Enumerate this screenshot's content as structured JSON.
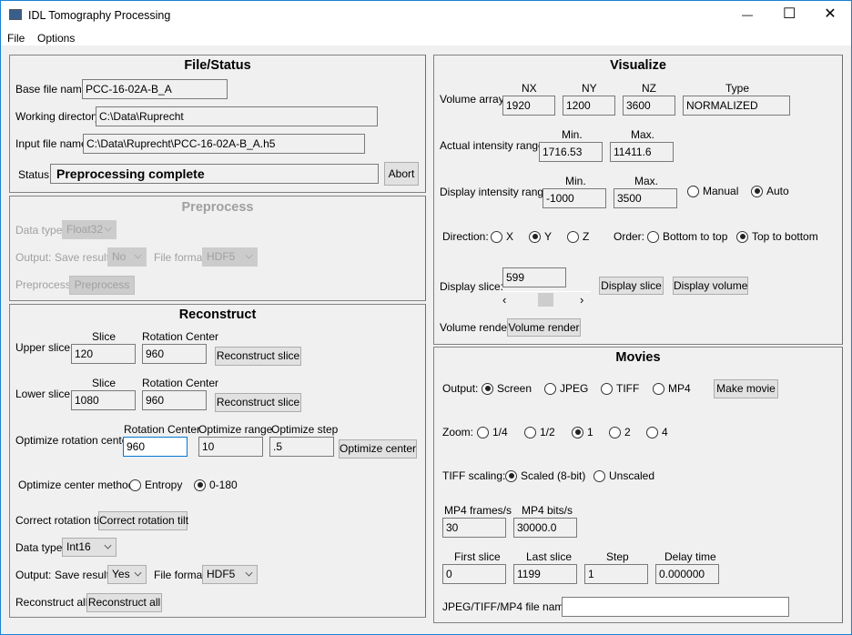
{
  "window": {
    "title": "IDL Tomography Processing",
    "minimize": "—",
    "maximize": "☐",
    "close": "✕"
  },
  "menu": {
    "file": "File",
    "options": "Options"
  },
  "file_status": {
    "title": "File/Status",
    "base_label": "Base file name:",
    "base_value": "PCC-16-02A-B_A",
    "workdir_label": "Working directory:",
    "workdir_value": "C:\\Data\\Ruprecht",
    "input_label": "Input file name:",
    "input_value": "C:\\Data\\Ruprecht\\PCC-16-02A-B_A.h5",
    "status_label": "Status:",
    "status_value": "Preprocessing complete",
    "abort": "Abort"
  },
  "preprocess": {
    "title": "Preprocess",
    "data_type_label": "Data type:",
    "data_type": "Float32",
    "output_label": "Output:",
    "save_label": "Save result:",
    "save_value": "No",
    "format_label": "File format:",
    "format_value": "HDF5",
    "preprocess_label": "Preprocess:",
    "preprocess_button": "Preprocess"
  },
  "reconstruct": {
    "title": "Reconstruct",
    "slice_header": "Slice",
    "rot_header": "Rotation Center",
    "upper_label": "Upper slice:",
    "upper_slice": "120",
    "upper_center": "960",
    "lower_label": "Lower slice:",
    "lower_slice": "1080",
    "lower_center": "960",
    "recon_slice_button": "Reconstruct slice",
    "opt_label": "Optimize rotation center:",
    "opt_center_header": "Rotation Center",
    "opt_range_header": "Optimize range",
    "opt_step_header": "Optimize step",
    "opt_center": "960",
    "opt_range": "10",
    "opt_step": ".5",
    "opt_button": "Optimize center",
    "method_label": "Optimize center method:",
    "method_options": [
      "Entropy",
      "0-180"
    ],
    "method_selected": 1,
    "tilt_label": "Correct rotation tilt:",
    "tilt_button": "Correct rotation tilt",
    "data_type_label": "Data type:",
    "data_type": "Int16",
    "output_label": "Output:",
    "save_label": "Save result:",
    "save_value": "Yes",
    "format_label": "File format:",
    "format_value": "HDF5",
    "all_label": "Reconstruct all:",
    "all_button": "Reconstruct all"
  },
  "visualize": {
    "title": "Visualize",
    "volume_label": "Volume array:",
    "nx_header": "NX",
    "ny_header": "NY",
    "nz_header": "NZ",
    "type_header": "Type",
    "nx": "1920",
    "ny": "1200",
    "nz": "3600",
    "type": "NORMALIZED",
    "actual_label": "Actual intensity range:",
    "min_header": "Min.",
    "max_header": "Max.",
    "actual_min": "1716.53",
    "actual_max": "11411.6",
    "display_label": "Display intensity range:",
    "display_min": "-1000",
    "display_max": "3500",
    "scale_options": [
      "Manual",
      "Auto"
    ],
    "scale_selected": 1,
    "direction_label": "Direction:",
    "direction_options": [
      "X",
      "Y",
      "Z"
    ],
    "direction_selected": 1,
    "order_label": "Order:",
    "order_options": [
      "Bottom to top",
      "Top to bottom"
    ],
    "order_selected": 1,
    "slice_label": "Display slice:",
    "slice_value": "599",
    "slider_fraction": 0.5,
    "display_slice_button": "Display slice",
    "display_volume_button": "Display volume",
    "render_label": "Volume render:",
    "render_button": "Volume render"
  },
  "movies": {
    "title": "Movies",
    "output_label": "Output:",
    "output_options": [
      "Screen",
      "JPEG",
      "TIFF",
      "MP4"
    ],
    "output_selected": 0,
    "make_button": "Make movie",
    "zoom_label": "Zoom:",
    "zoom_options": [
      "1/4",
      "1/2",
      "1",
      "2",
      "4"
    ],
    "zoom_selected": 2,
    "tiff_label": "TIFF scaling:",
    "tiff_options": [
      "Scaled (8-bit)",
      "Unscaled"
    ],
    "tiff_selected": 0,
    "frames_header": "MP4 frames/s",
    "bits_header": "MP4 bits/s",
    "frames": "30",
    "bits": "30000.0",
    "first_header": "First slice",
    "last_header": "Last slice",
    "step_header": "Step",
    "delay_header": "Delay time",
    "first": "0",
    "last": "1199",
    "step": "1",
    "delay": "0.000000",
    "filename_label": "JPEG/TIFF/MP4 file name:",
    "filename": ""
  }
}
